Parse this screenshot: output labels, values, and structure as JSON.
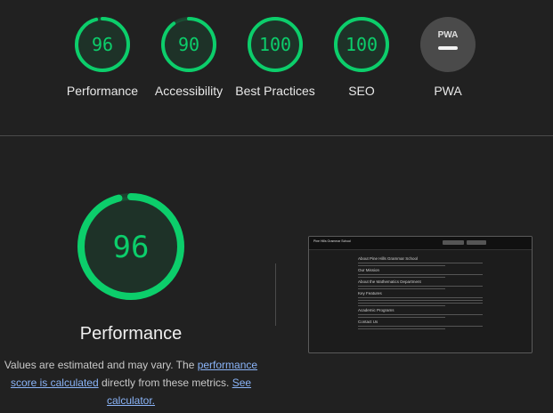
{
  "categories": [
    {
      "label": "Performance",
      "score": "96",
      "score_value": 96,
      "color": "#0cce6b"
    },
    {
      "label": "Accessibility",
      "score": "90",
      "score_value": 90,
      "color": "#0cce6b"
    },
    {
      "label": "Best Practices",
      "score": "100",
      "score_value": 100,
      "color": "#0cce6b"
    },
    {
      "label": "SEO",
      "score": "100",
      "score_value": 100,
      "color": "#0cce6b"
    },
    {
      "label": "PWA",
      "score": "",
      "icon": "pwa-icon",
      "color": "#9e9e9e"
    }
  ],
  "main": {
    "title": "Performance",
    "score": "96",
    "score_value": 96,
    "color": "#0cce6b",
    "description_prefix": "Values are estimated and may vary. The ",
    "link1": "performance score is calculated",
    "description_middle": " directly from these metrics. ",
    "link2": "See calculator."
  },
  "screenshot": {
    "brand": "Pine Hills Grammar School",
    "headings": [
      "About Pine Hills Grammar School",
      "Our Mission",
      "About the Mathematics Department",
      "Key Features",
      "Academic Programs",
      "Contact Us"
    ]
  }
}
